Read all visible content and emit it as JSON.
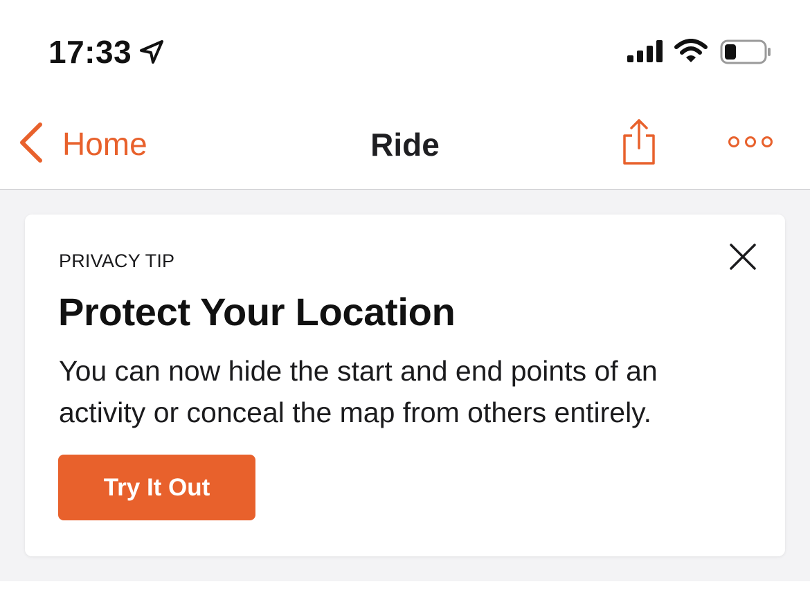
{
  "status_bar": {
    "time": "17:33",
    "location_icon": "location-arrow-icon",
    "signal_icon": "cellular-signal-icon",
    "wifi_icon": "wifi-icon",
    "battery_icon": "battery-icon",
    "battery_level": 0.2
  },
  "nav": {
    "back_label": "Home",
    "title": "Ride",
    "share_icon": "share-icon",
    "more_icon": "more-options-icon"
  },
  "card": {
    "eyebrow": "PRIVACY TIP",
    "title": "Protect Your Location",
    "body": "You can now hide the start and end points of an activity or conceal the map from others entirely.",
    "cta_label": "Try It Out",
    "close_icon": "close-icon"
  },
  "colors": {
    "accent": "#e8612c",
    "background": "#f3f3f5",
    "card": "#ffffff",
    "text": "#1b1b1d"
  }
}
